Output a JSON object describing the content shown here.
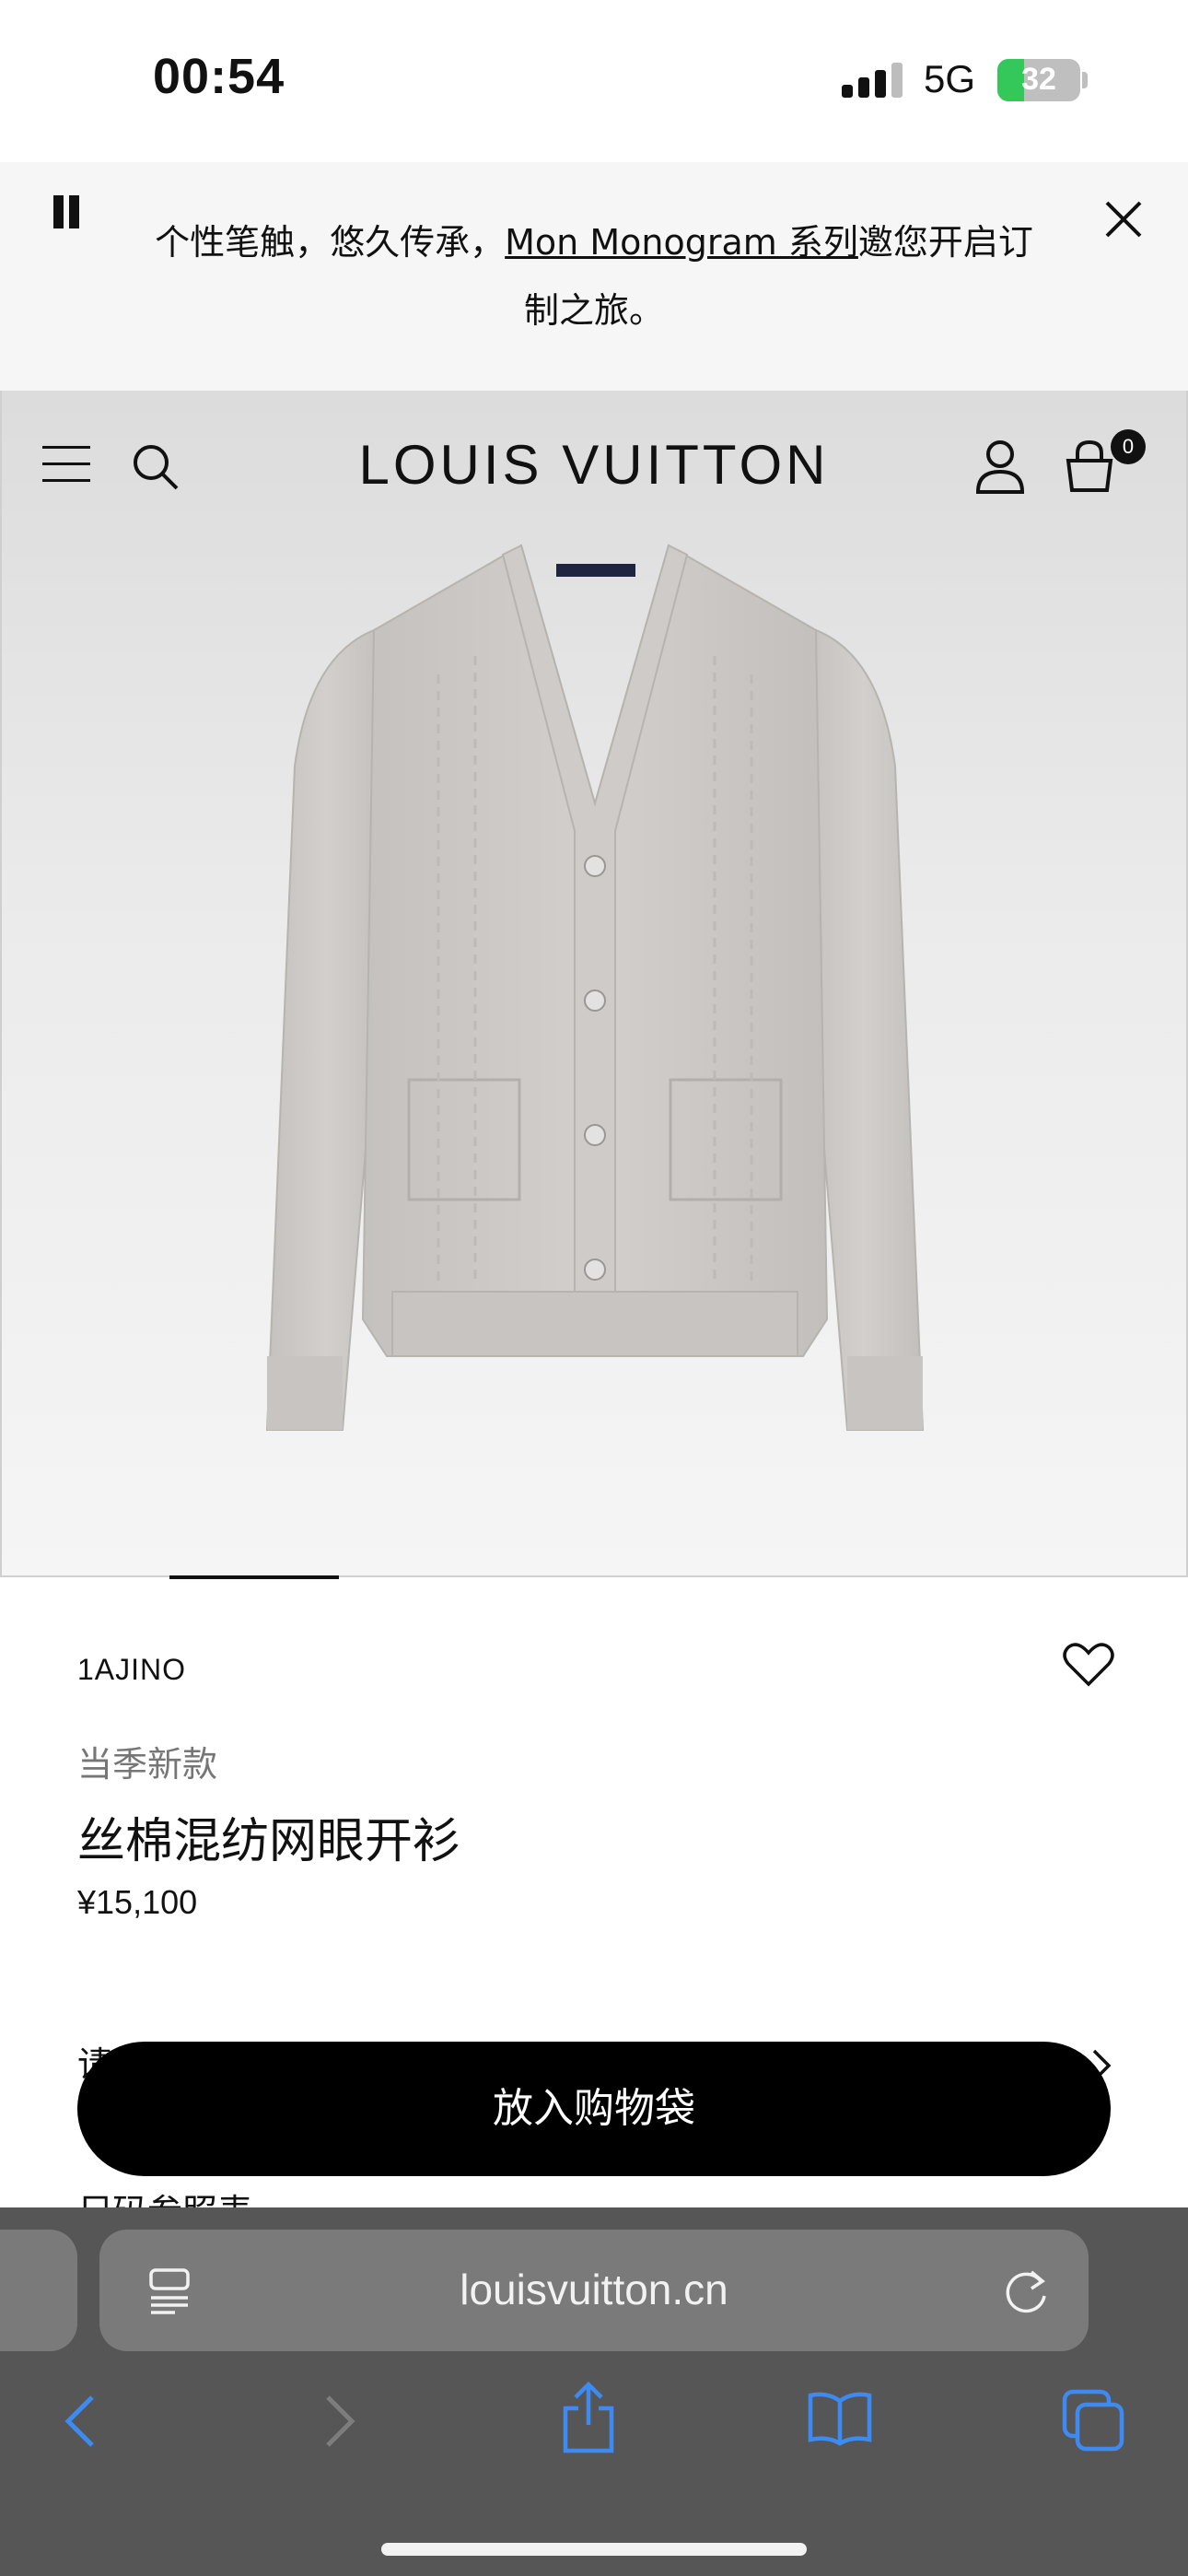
{
  "status_bar": {
    "time": "00:54",
    "network": "5G",
    "battery": "32",
    "battery_level": 0.32
  },
  "banner": {
    "text_before": "个性笔触，悠久传承，",
    "link_text": "Mon Monogram 系列",
    "text_after": "邀您开启订制之旅。"
  },
  "header": {
    "brand": "LOUIS VUITTON",
    "bag_count": "0"
  },
  "product": {
    "sku": "1AJINO",
    "season_tag": "当季新款",
    "name": "丝棉混纺网眼开衫",
    "price": "¥15,100"
  },
  "partial_rows": [
    "请",
    "尺码参照表"
  ],
  "cta": {
    "add_to_bag": "放入购物袋"
  },
  "browser": {
    "url": "louisvuitton.cn"
  },
  "icons": [
    "pause-icon",
    "close-icon",
    "menu-icon",
    "search-icon",
    "account-icon",
    "shopping-bag-icon",
    "heart-icon",
    "chevron-right-icon",
    "reader-icon",
    "reload-icon",
    "back-icon",
    "forward-icon",
    "share-icon",
    "bookmarks-icon",
    "tabs-icon"
  ],
  "colors": {
    "accent": "#000000",
    "battery_green": "#34c759",
    "muted_text": "#767676",
    "browser_bar": "#565656"
  }
}
